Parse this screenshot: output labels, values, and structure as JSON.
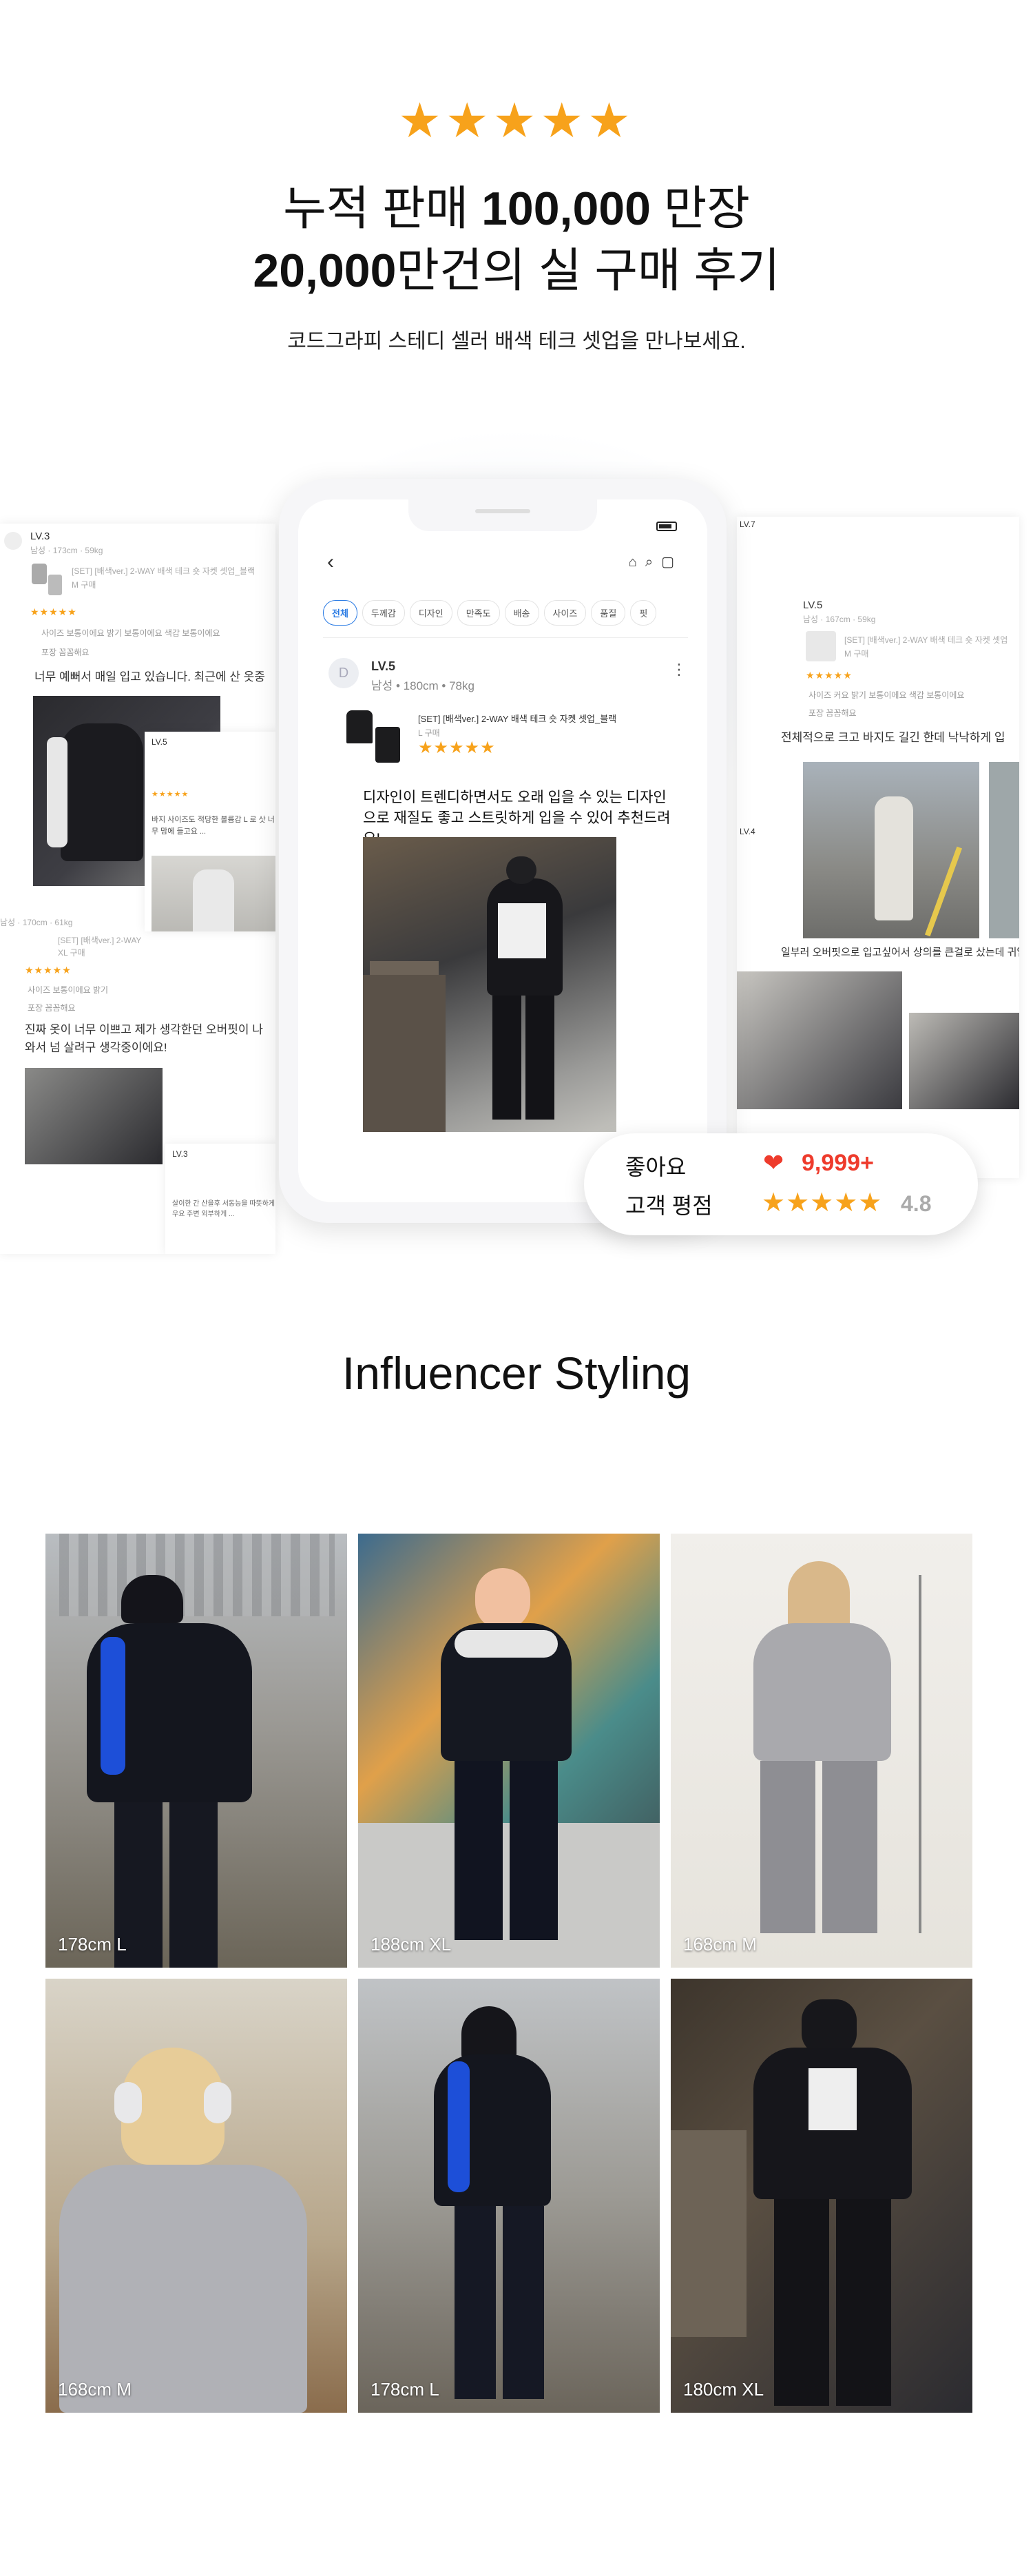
{
  "hero": {
    "stars": "★★★★★",
    "headline_line1_pre": "누적 판매 ",
    "headline_line1_bold": "100,000",
    "headline_line1_post": " 만장",
    "headline_line2_bold": "20,000",
    "headline_line2_post": "만건의 실 구매 후기",
    "subline": "코드그라피 스테디 셀러 배색 테크 셋업을 만나보세요."
  },
  "bg_reviews": {
    "left_lv": "LV.3",
    "left_meta": "남성 · 173cm · 59kg",
    "left_product": "[SET] [배색ver.] 2-WAY 배색 테크 숏 자켓 셋업_블랙",
    "left_opt": "M 구매",
    "left_tags": "사이즈 보통이에요   밝기 보통이에요   색감 보통이에요",
    "left_tags2": "포장 꼼꼼해요",
    "left_text": "너무 예뻐서 매일 입고 있습니다. 최근에 산 옷중",
    "left2_meta": "남성 · 170cm · 61kg",
    "left2_product": "[SET] [배색ver.] 2-WAY",
    "left2_opt": "XL 구매",
    "left2_tags": "사이즈 보통이에요   밝기",
    "left2_tags2": "포장 꼼꼼해요",
    "left2_text": "진짜 옷이 너무 이쁘고 제가 생각한던 오버핏이 나와서 넘 살려구 생각중이에요!",
    "left_inner_lv": "LV.5",
    "left_inner_text": "바지 사이즈도 적당한 볼륨감 L 로 삿 너무 맘에 들고요 ...",
    "left_inner2_lv": "LV.3",
    "left_inner2_text": "살이한 간 산을후 서동능을 따뜻하게 우요 주변 외부하게 ...",
    "right_lv": "LV.5",
    "right_meta": "남성 · 167cm · 59kg",
    "right_product": "[SET] [배색ver.] 2-WAY 배색 테크 숏 자켓 셋업",
    "right_opt": "M 구매",
    "right_tags": "사이즈 커요   밝기 보통이에요   색감 보통이에요",
    "right_tags2": "포장 꼼꼼해요",
    "right_text": "전체적으로 크고 바지도 길긴 한데 낙낙하게 입",
    "right2_text": "일부러 오버핏으로 입고싶어서 상의를 큰걸로 샀는데 귀엽고",
    "right_lv7": "LV.7",
    "right_lv4": "LV.4"
  },
  "phone": {
    "chips": [
      "전체",
      "두께감",
      "디자인",
      "만족도",
      "배송",
      "사이즈",
      "품질",
      "핏"
    ],
    "review": {
      "avatar_initial": "D",
      "level": "LV.5",
      "meta": "남성 • 180cm • 78kg",
      "product_name": "[SET] [배색ver.] 2-WAY 배색 테크 숏 자켓 셋업_블랙",
      "product_option": "L 구매",
      "stars": "★★★★★",
      "text": "디자인이 트렌디하면서도 오래 입을 수 있는 디자인으로 재질도 좋고 스트릿하게 입을 수 있어 추천드려요!"
    }
  },
  "badge": {
    "likes_label": "좋아요",
    "likes_value": "9,999+",
    "rating_label": "고객 평점",
    "rating_stars": "★★★★★",
    "rating_value": "4.8"
  },
  "influencer": {
    "title": "Influencer Styling",
    "tiles": [
      {
        "caption": "178cm L"
      },
      {
        "caption": "188cm XL"
      },
      {
        "caption": "168cm M"
      },
      {
        "caption": "168cm M"
      },
      {
        "caption": "178cm L"
      },
      {
        "caption": "180cm XL"
      }
    ]
  }
}
